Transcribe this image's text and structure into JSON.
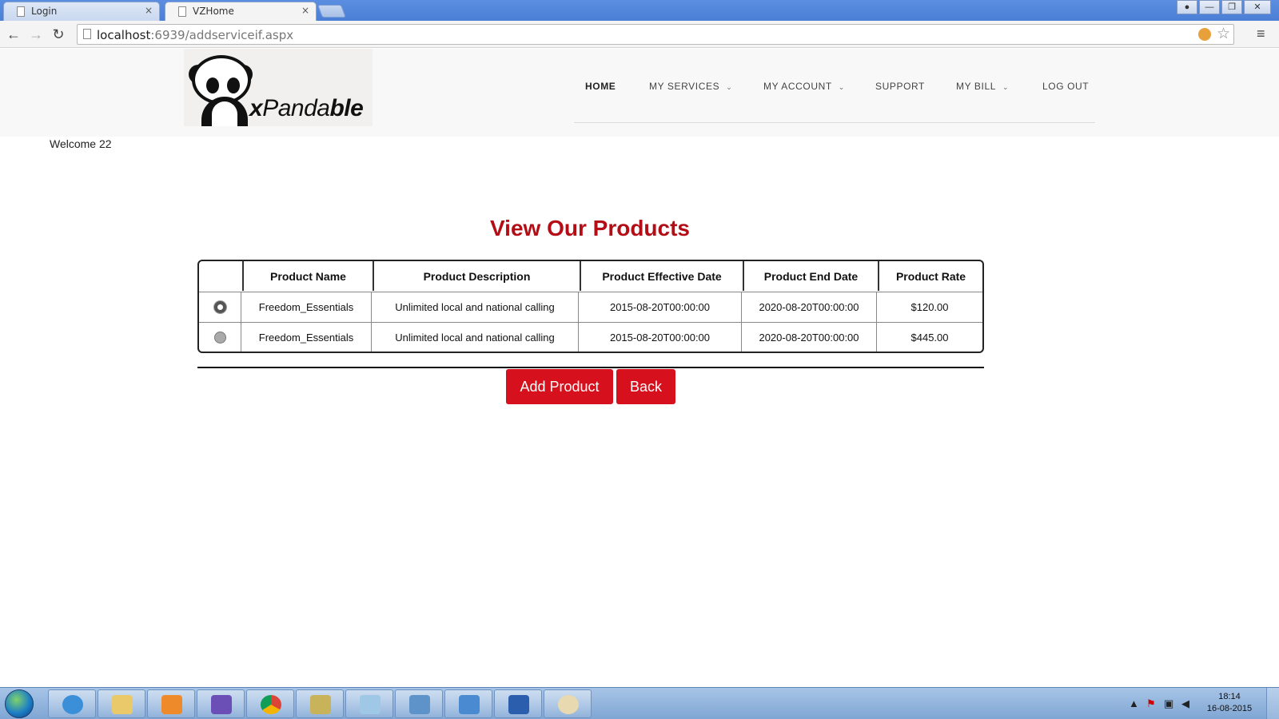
{
  "browser": {
    "tabs": [
      {
        "title": "Login",
        "close": "×"
      },
      {
        "title": "VZHome",
        "close": "×"
      }
    ],
    "url_host": "localhost",
    "url_rest": ":6939/addserviceif.aspx",
    "window_buttons": [
      "—",
      "❐",
      "✕"
    ]
  },
  "site": {
    "logo": {
      "text_x": "x",
      "text_mid": "Panda",
      "text_end": "ble"
    },
    "nav": [
      {
        "label": "HOME",
        "caret": ""
      },
      {
        "label": "MY SERVICES",
        "caret": "⌄"
      },
      {
        "label": "MY ACCOUNT",
        "caret": "⌄"
      },
      {
        "label": "SUPPORT",
        "caret": ""
      },
      {
        "label": "MY BILL",
        "caret": "⌄"
      },
      {
        "label": "LOG OUT",
        "caret": ""
      }
    ]
  },
  "content": {
    "welcome": "Welcome 22",
    "title": "View Our Products",
    "table": {
      "columns": [
        "",
        "Product Name",
        "Product Description",
        "Product Effective Date",
        "Product End Date",
        "Product Rate"
      ],
      "rows": [
        {
          "selected": true,
          "name": "Freedom_Essentials",
          "description": "Unlimited local and national calling",
          "effective": "2015-08-20T00:00:00",
          "end": "2020-08-20T00:00:00",
          "rate": "$120.00"
        },
        {
          "selected": false,
          "name": "Freedom_Essentials",
          "description": "Unlimited local and national calling",
          "effective": "2015-08-20T00:00:00",
          "end": "2020-08-20T00:00:00",
          "rate": "$445.00"
        }
      ]
    },
    "buttons": {
      "add": "Add Product",
      "back": "Back"
    }
  },
  "taskbar": {
    "apps": [
      "internet-explorer",
      "file-explorer",
      "media-player",
      "visual-studio",
      "chrome",
      "tools",
      "notepad",
      "control-panel",
      "windows-update",
      "word",
      "paint"
    ],
    "clock_time": "18:14",
    "clock_date": "16-08-2015"
  }
}
